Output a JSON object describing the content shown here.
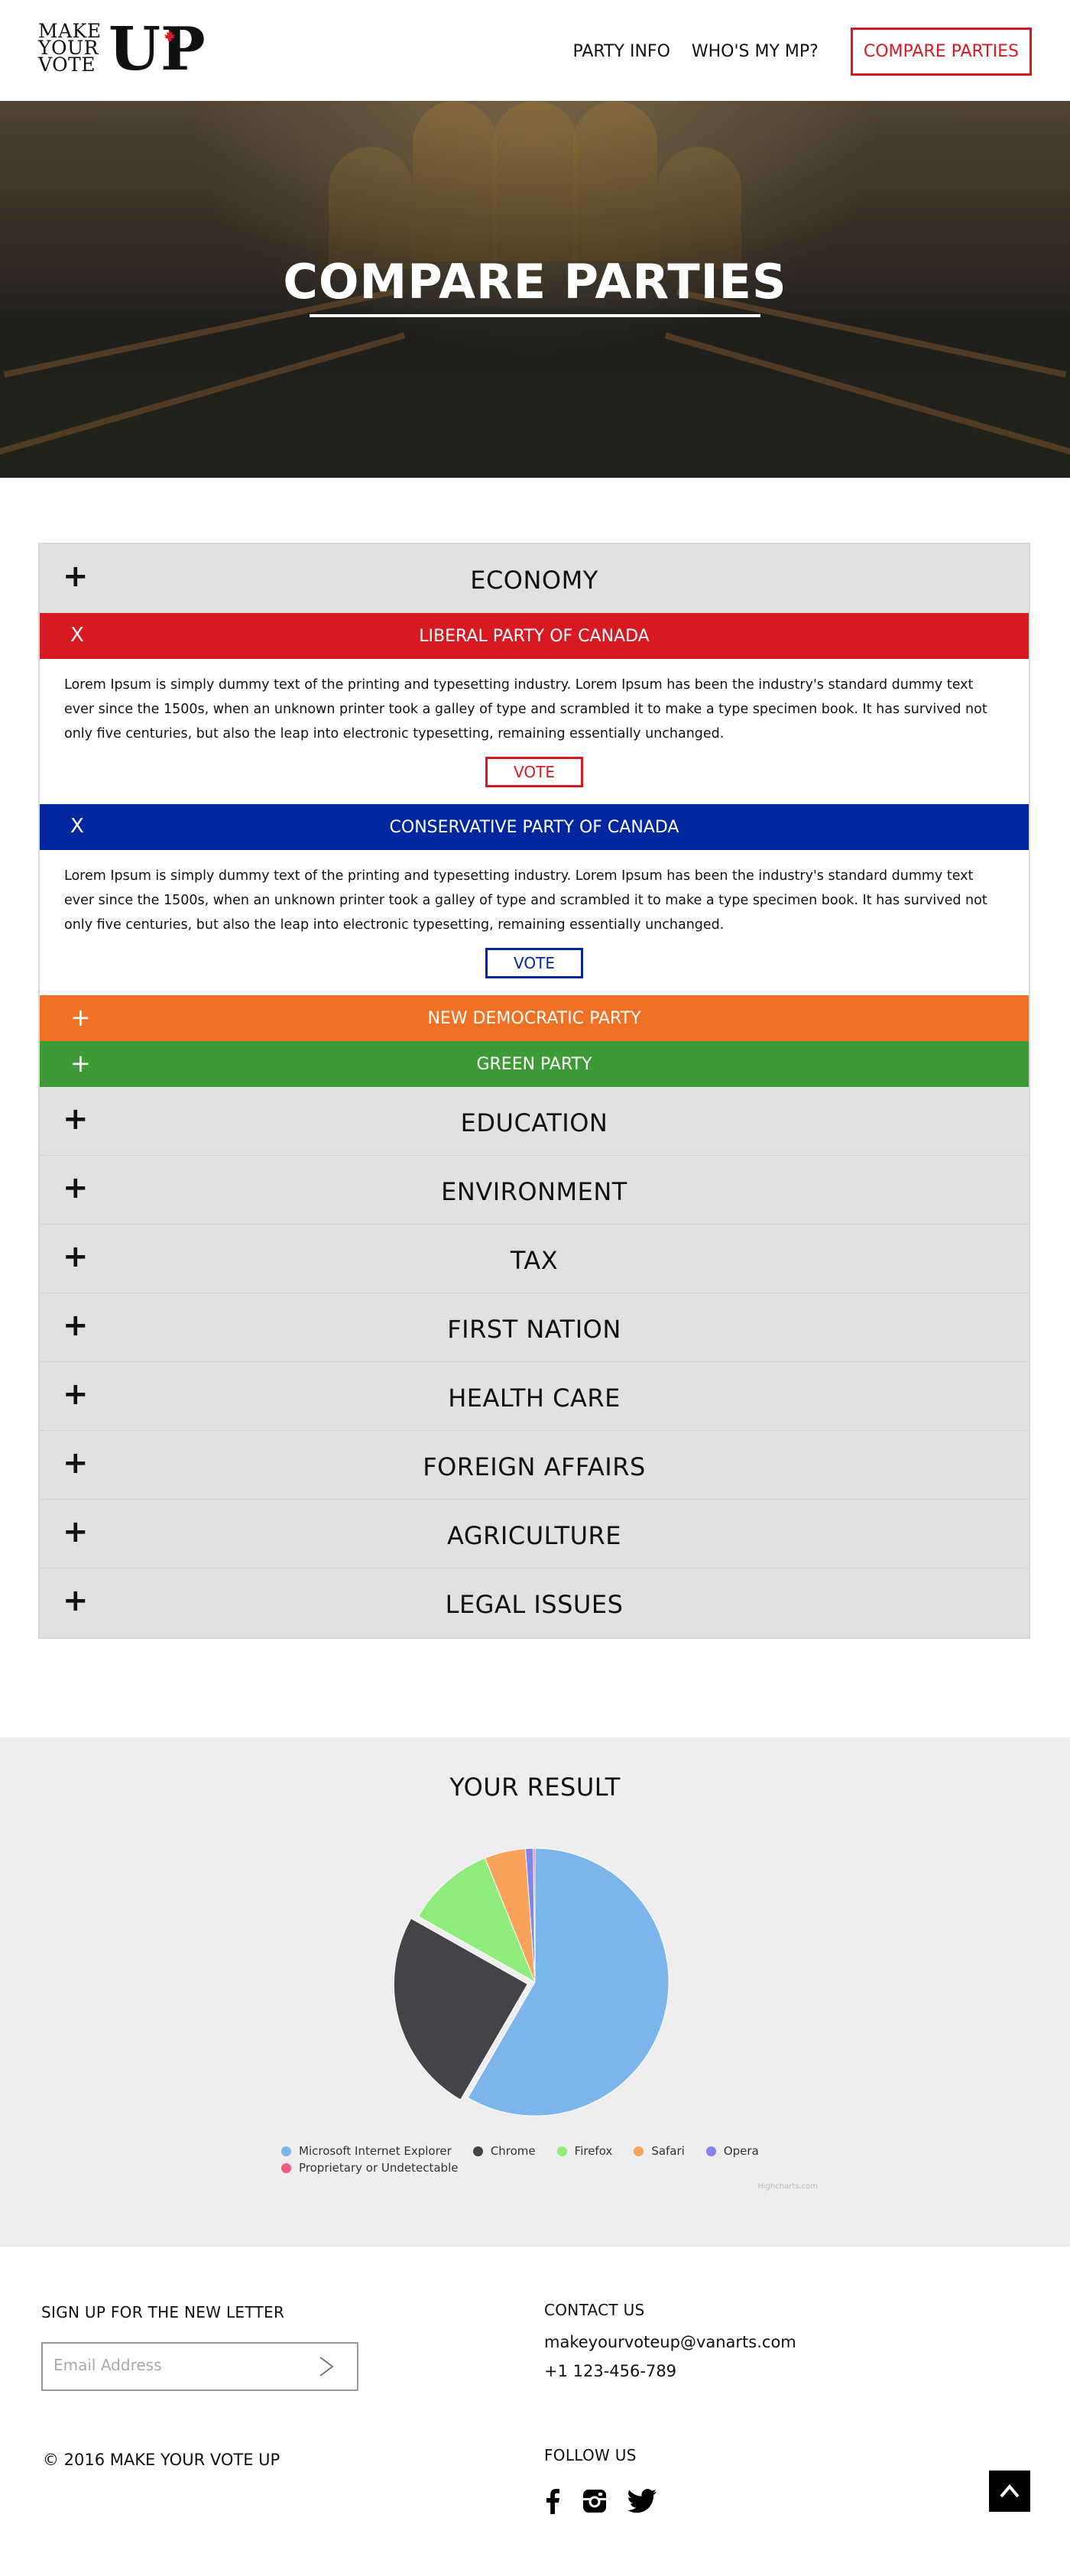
{
  "header": {
    "logo": {
      "line1": "MAKE",
      "line2": "YOUR",
      "line3": "VOTE",
      "big": "UP"
    },
    "nav": [
      {
        "label": "PARTY INFO"
      },
      {
        "label": "WHO'S MY MP?"
      }
    ],
    "cta_label": "COMPARE PARTIES"
  },
  "hero": {
    "title": "COMPARE PARTIES"
  },
  "accordion": {
    "economy": {
      "label": "ECONOMY",
      "icon": "+",
      "parties": {
        "liberal": {
          "name": "LIBERAL PARTY OF CANADA",
          "toggle": "X",
          "color": "#d71a21",
          "text": "Lorem Ipsum is simply dummy text of the printing and typesetting industry. Lorem Ipsum has been the industry's standard dummy text ever since the 1500s, when an unknown printer took a galley of type and scrambled it to make a type specimen book. It has survived not only five centuries, but also the leap into electronic typesetting, remaining essentially unchanged.",
          "vote_label": "VOTE"
        },
        "conservative": {
          "name": "CONSERVATIVE PARTY OF CANADA",
          "toggle": "X",
          "color": "#0027a0",
          "text": "Lorem Ipsum is simply dummy text of the printing and typesetting industry. Lorem Ipsum has been the industry's standard dummy text ever since the 1500s, when an unknown printer took a galley of type and scrambled it to make a type specimen book. It has survived not only five centuries, but also the leap into electronic typesetting, remaining essentially unchanged.",
          "vote_label": "VOTE"
        },
        "ndp": {
          "name": "NEW DEMOCRATIC PARTY",
          "toggle": "+",
          "color": "#f07124"
        },
        "green": {
          "name": "GREEN PARTY",
          "toggle": "+",
          "color": "#3d9b35"
        }
      }
    },
    "topics": [
      {
        "label": "EDUCATION",
        "icon": "+"
      },
      {
        "label": "ENVIRONMENT",
        "icon": "+"
      },
      {
        "label": "TAX",
        "icon": "+"
      },
      {
        "label": "FIRST NATION",
        "icon": "+"
      },
      {
        "label": "HEALTH CARE",
        "icon": "+"
      },
      {
        "label": "FOREIGN AFFAIRS",
        "icon": "+"
      },
      {
        "label": "AGRICULTURE",
        "icon": "+"
      },
      {
        "label": "LEGAL ISSUES",
        "icon": "+"
      }
    ]
  },
  "result": {
    "title": "YOUR RESULT",
    "credit": "Highcharts.com"
  },
  "chart_data": {
    "type": "pie",
    "title": "YOUR RESULT",
    "series": [
      {
        "name": "",
        "slices": [
          {
            "label": "Microsoft Internet Explorer",
            "value": 56.5,
            "color": "#7cb5ec"
          },
          {
            "label": "Chrome",
            "value": 24.0,
            "color": "#434348"
          },
          {
            "label": "Firefox",
            "value": 10.4,
            "color": "#90ed7d"
          },
          {
            "label": "Safari",
            "value": 4.8,
            "color": "#f7a35c"
          },
          {
            "label": "Opera",
            "value": 0.9,
            "color": "#8085e9"
          },
          {
            "label": "Proprietary or Undetectable",
            "value": 0.2,
            "color": "#f15c80"
          }
        ]
      }
    ],
    "legend_position": "bottom",
    "exploded_slice": "Chrome"
  },
  "footer": {
    "newsletter_title": "SIGN UP FOR THE NEW LETTER",
    "email_placeholder": "Email Address",
    "send_icon": "chevron-right-icon",
    "contact_title": "CONTACT US",
    "email": "makeyourvoteup@vanarts.com",
    "phone": "+1 123-456-789",
    "copyright": "© 2016 MAKE YOUR VOTE UP",
    "follow_title": "FOLLOW US",
    "social": [
      "facebook-icon",
      "instagram-icon",
      "twitter-icon"
    ],
    "back_to_top_icon": "chevron-up-icon"
  }
}
